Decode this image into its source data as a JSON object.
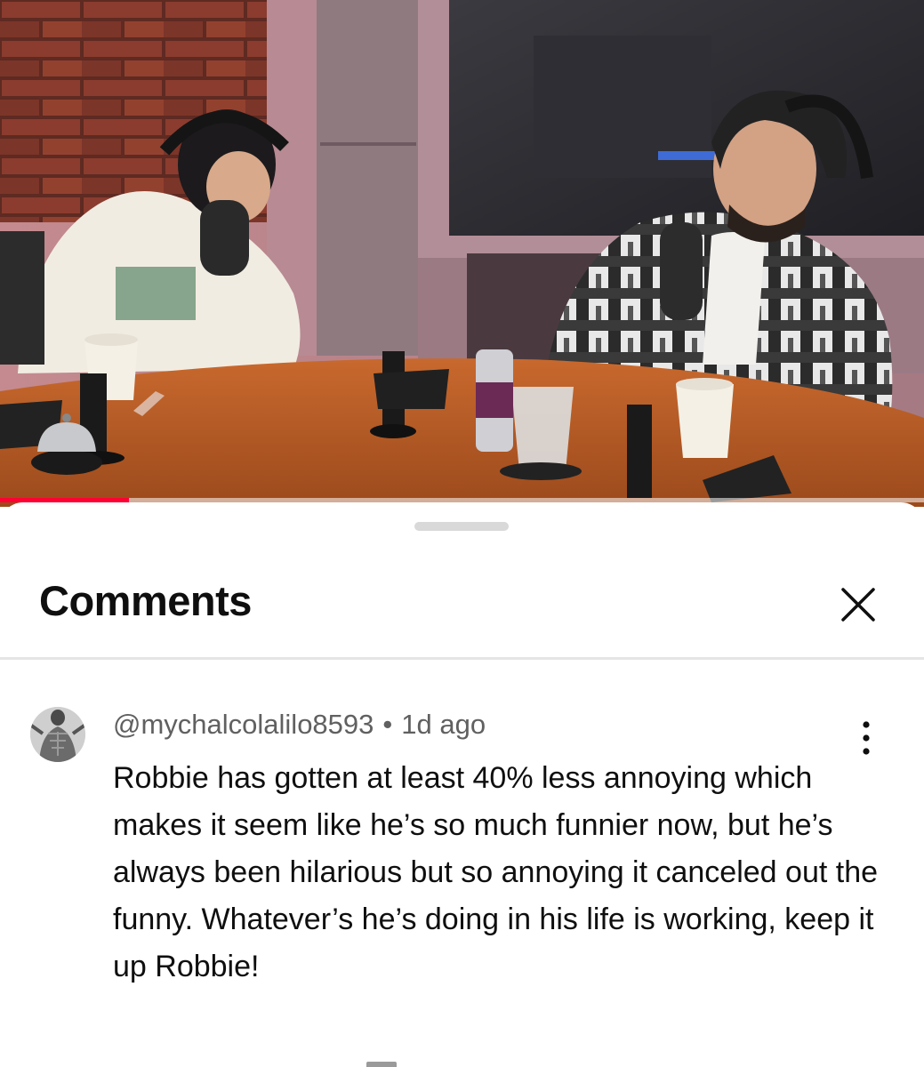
{
  "video": {
    "progress_fraction": 0.14,
    "progress_color": "#ff0033"
  },
  "sheet": {
    "title": "Comments",
    "close_icon": "close-icon"
  },
  "comments": [
    {
      "author": "@mychalcolalilo8593",
      "separator": "•",
      "time": "1d ago",
      "text": "Robbie has gotten at least 40% less annoying which makes it seem like he’s so much funnier now, but he’s always been hilarious but so annoying it canceled out the funny. Whatever’s he’s doing in his life is working, keep it up Robbie!",
      "more_icon": "more-vertical-icon"
    }
  ],
  "colors": {
    "title_text": "#0f0f0f",
    "meta_text": "#606060",
    "divider": "#e5e5e5",
    "handle": "#d9d9d9"
  }
}
